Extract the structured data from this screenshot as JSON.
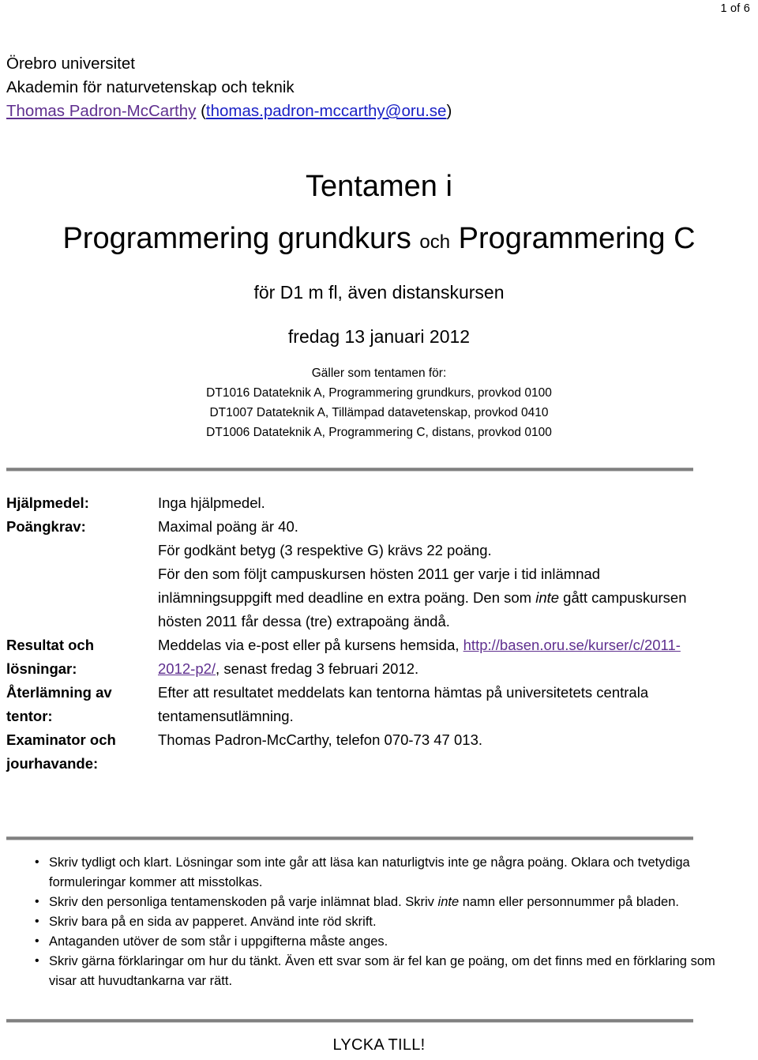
{
  "page_indicator": "1 of 6",
  "header": {
    "university": "Örebro universitet",
    "department": "Akademin för naturvetenskap och teknik",
    "author_name": "Thomas Padron-McCarthy",
    "paren_open": " (",
    "author_email": "thomas.padron-mccarthy@oru.se",
    "paren_close": ")"
  },
  "title": {
    "line1": "Tentamen i",
    "course_part1": "Programmering grundkurs",
    "course_conj": "och",
    "course_part2": "Programmering C",
    "audience": "för D1 m fl, även distanskursen",
    "date": "fredag 13 januari 2012"
  },
  "applies": {
    "heading": "Gäller som tentamen för:",
    "courses": [
      "DT1016 Datateknik A, Programmering grundkurs, provkod 0100",
      "DT1007 Datateknik A, Tillämpad datavetenskap, provkod 0410",
      "DT1006 Datateknik A, Programmering C, distans, provkod 0100"
    ]
  },
  "info": {
    "aids_label": "Hjälpmedel:",
    "aids_value": "Inga hjälpmedel.",
    "points_label": "Poängkrav:",
    "points_line1": "Maximal poäng är 40.",
    "points_line2": "För godkänt betyg (3 respektive G) krävs 22 poäng.",
    "points_line3_a": "För den som följt campuskursen hösten 2011 ger varje i tid inlämnad inlämningsuppgift med deadline en extra poäng. Den som ",
    "points_line3_em": "inte",
    "points_line3_b": " gått campuskursen hösten 2011 får dessa (tre) extrapoäng ändå.",
    "results_label_line1": "Resultat och",
    "results_label_line2": "lösningar:",
    "results_pre": "Meddelas via e-post eller på kursens hemsida, ",
    "results_link_part1": "http://basen.oru.se",
    "results_link_part2": "/kurser/c/2011-2012-p2/",
    "results_post": ", senast fredag 3 februari 2012.",
    "return_label_line1": "Återlämning av",
    "return_label_line2": "tentor:",
    "return_value": "Efter att resultatet meddelats kan tentorna hämtas på universitetets centrala tentamensutlämning.",
    "examiner_label_line1": "Examinator och",
    "examiner_label_line2": "jourhavande:",
    "examiner_value": "Thomas Padron-McCarthy, telefon 070-73 47 013."
  },
  "instructions": [
    {
      "before": "Skriv tydligt och klart. Lösningar som inte går att läsa kan naturligtvis inte ge några poäng. Oklara och tvetydiga formuleringar kommer att misstolkas.",
      "em": "",
      "after": ""
    },
    {
      "before": "Skriv den personliga tentamenskoden på varje inlämnat blad. Skriv ",
      "em": "inte",
      "after": " namn eller personnummer på bladen."
    },
    {
      "before": "Skriv bara på en sida av papperet. Använd inte röd skrift.",
      "em": "",
      "after": ""
    },
    {
      "before": "Antaganden utöver de som står i uppgifterna måste anges.",
      "em": "",
      "after": ""
    },
    {
      "before": "Skriv gärna förklaringar om hur du tänkt. Även ett svar som är fel kan ge poäng, om det finns med en förklaring som visar att huvudtankarna var rätt.",
      "em": "",
      "after": ""
    }
  ],
  "footer": {
    "good_luck": "LYCKA TILL!"
  },
  "colors": {
    "visited_link": "#5f2f8f",
    "unvisited_link": "#1a21c6",
    "rule": "#808080",
    "text": "#000000"
  },
  "bullet_glyph": "•"
}
